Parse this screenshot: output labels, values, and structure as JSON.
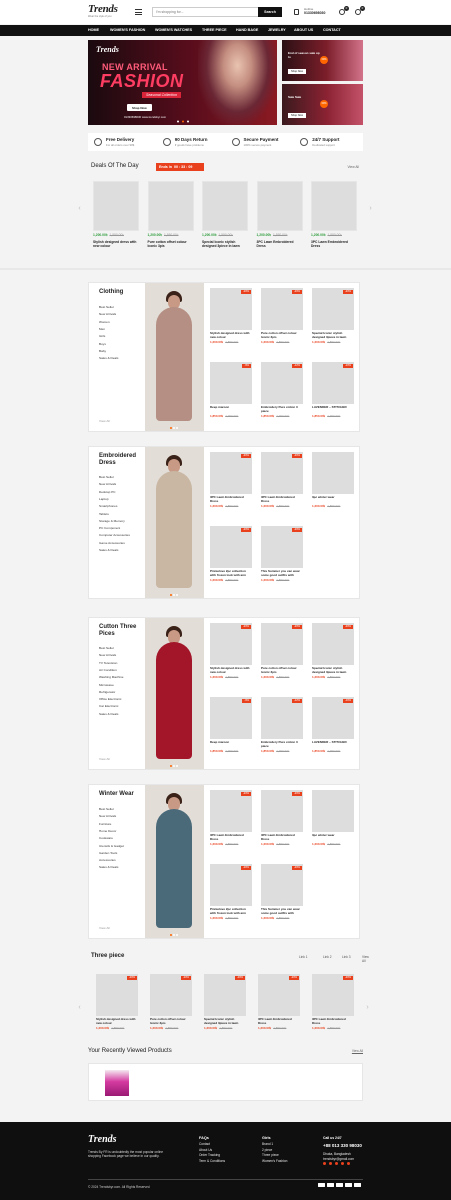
{
  "header": {
    "logo": "Trends",
    "logo_tagline": "Wear the style of you",
    "search_placeholder": "I'm shopping for...",
    "search_button": "Search",
    "hotline_label": "Hotline",
    "hotline_number": "01330698030",
    "wishlist_count": "0",
    "cart_count": "0"
  },
  "nav": [
    "Home",
    "Women's Fashion",
    "Women's Watches",
    "Three Piece",
    "Hand Bage",
    "Jewelry",
    "About Us",
    "Contact"
  ],
  "banner": {
    "brand": "Trends",
    "line1": "NEW ARRIVAL",
    "line2": "FASHION",
    "subtitle": "Seasonal Collection",
    "button": "Shop Now",
    "contact": "01330698030   www.trendsbyr.com"
  },
  "side_banners": [
    {
      "text": "End of season sale up to",
      "badge": "30%",
      "button": "Shop Now"
    },
    {
      "text": "Sale Sale",
      "badge": "30%",
      "button": "Shop Now"
    }
  ],
  "services": [
    {
      "title": "Free Delivery",
      "sub": "For all orders over 90$",
      "icon": "truck-icon"
    },
    {
      "title": "90 Days Return",
      "sub": "If goods have problems",
      "icon": "return-icon"
    },
    {
      "title": "Secure Payment",
      "sub": "100% secure payment",
      "icon": "card-icon"
    },
    {
      "title": "24/7 Support",
      "sub": "Dedicated support",
      "icon": "support-icon"
    }
  ],
  "deals": {
    "title": "Deals Of The Day",
    "ends_label": "Ends In",
    "timer": "00 : 33 : 09",
    "view_all": "View All",
    "products": [
      {
        "price": "1,200.00৳",
        "old": "1,550.00৳",
        "name": "Stylish designed dress with new colour",
        "img": "i1"
      },
      {
        "price": "1,200.00৳",
        "old": "1,550.00৳",
        "name": "Pure cotton offset colour Iconic 3pis",
        "img": "i2"
      },
      {
        "price": "1,200.00৳",
        "old": "1,550.00৳",
        "name": "Special Iconic stylish designed 3piece in lawn",
        "img": "i3"
      },
      {
        "price": "1,200.00৳",
        "old": "1,550.00৳",
        "name": "3PC Lawn Embroidered Dress",
        "img": "i4"
      },
      {
        "price": "1,200.00৳",
        "old": "1,550.00৳",
        "name": "3PC Lawn Embroidered Dress",
        "img": "i5"
      }
    ]
  },
  "categories": [
    {
      "title": "Clothing",
      "links": [
        "Best Seller",
        "New Arrivals",
        "Women",
        "Men",
        "Girls",
        "Boys",
        "Baby",
        "Sales & Deals"
      ],
      "view_all": "View All",
      "products": [
        {
          "name": "Stylish designed dress with new colour",
          "price": "1,200.00৳",
          "old": "1,550.00৳",
          "badge": "-20%",
          "img": "i1"
        },
        {
          "name": "Pure cotton offset colour Iconic 3pis",
          "price": "1,200.00৳",
          "old": "1,550.00৳",
          "badge": "-20%",
          "img": "i2"
        },
        {
          "name": "Special Iconic stylish designed 3piece in lawn",
          "price": "1,200.00৳",
          "old": "1,550.00৳",
          "badge": "-20%",
          "img": "i3"
        },
        {
          "name": "Deep maroon",
          "price": "1,850.00৳",
          "old": "1,900.00৳",
          "badge": "-9%",
          "img": "i6"
        },
        {
          "name": "Embroidery Pure cotton 3 piece",
          "price": "1,850.00৳",
          "old": "1,900.00৳",
          "badge": "-12%",
          "img": "i7"
        },
        {
          "name": "LAVENDER – STITCHED",
          "price": "1,850.00৳",
          "old": "1,900.00৳",
          "badge": "-10%",
          "img": "i8"
        }
      ]
    },
    {
      "title": "Embroidered Dress",
      "links": [
        "Best Seller",
        "New Arrivals",
        "Desktop PC",
        "Laptop",
        "Smartphones",
        "Tablets",
        "Storage & Memory",
        "PC Component",
        "Computer Accessories",
        "Game Accessories",
        "Sales & Deals"
      ],
      "view_all": "",
      "products": [
        {
          "name": "3PC Lawn Embroidered Dress",
          "price": "1,200.00৳",
          "old": "1,550.00৳",
          "badge": "-20%",
          "img": "i9"
        },
        {
          "name": "3PC Lawn Embroidered Dress",
          "price": "1,200.00৳",
          "old": "1,550.00৳",
          "badge": "-20%",
          "img": "i5"
        },
        {
          "name": "3pc winter wear",
          "price": "1,200.00৳",
          "old": "1,550.00৳",
          "badge": "",
          "img": "i10"
        },
        {
          "name": "Pinnielove 2pc collection with frozen look with ann Fashion",
          "price": "1,200.00৳",
          "old": "1,550.00৳",
          "badge": "-20%",
          "img": "i11"
        },
        {
          "name": "This Summer you can wear some good outfits with stylish",
          "price": "1,200.00৳",
          "old": "1,550.00৳",
          "badge": "-20%",
          "img": "i12"
        }
      ]
    },
    {
      "title": "Cutton Three Pices",
      "links": [
        "Best Seller",
        "New Arrivals",
        "TV Television",
        "Air Condition",
        "Washing Machine",
        "Microwave",
        "Refrigerator",
        "Office Electronic",
        "Car Electronic",
        "Sales & Deals"
      ],
      "view_all": "View All",
      "products": [
        {
          "name": "Stylish designed dress with new colour",
          "price": "1,200.00৳",
          "old": "1,550.00৳",
          "badge": "-20%",
          "img": "i1"
        },
        {
          "name": "Pure cotton offset colour Iconic 3pis",
          "price": "1,200.00৳",
          "old": "1,550.00৳",
          "badge": "-20%",
          "img": "i2"
        },
        {
          "name": "Special Iconic stylish designed 3piece in lawn",
          "price": "1,200.00৳",
          "old": "1,550.00৳",
          "badge": "-20%",
          "img": "i3"
        },
        {
          "name": "Deep maroon",
          "price": "1,850.00৳",
          "old": "1,900.00৳",
          "badge": "-9%",
          "img": "i6"
        },
        {
          "name": "Embroidery Pure cotton 3 piece",
          "price": "1,850.00৳",
          "old": "1,900.00৳",
          "badge": "-12%",
          "img": "i7"
        },
        {
          "name": "LAVENDER – STITCHED",
          "price": "1,850.00৳",
          "old": "1,900.00৳",
          "badge": "-10%",
          "img": "i8"
        }
      ]
    },
    {
      "title": "Winter Wear",
      "links": [
        "Best Seller",
        "New Arrivals",
        "Furniture",
        "Home Decor",
        "Cookware",
        "Utensils & Gadget",
        "Garden Tools",
        "Accessories",
        "Sales & Deals"
      ],
      "view_all": "View All",
      "products": [
        {
          "name": "3PC Lawn Embroidered Dress",
          "price": "1,200.00৳",
          "old": "1,550.00৳",
          "badge": "-20%",
          "img": "i9"
        },
        {
          "name": "3PC Lawn Embroidered Dress",
          "price": "1,200.00৳",
          "old": "1,550.00৳",
          "badge": "-20%",
          "img": "i5"
        },
        {
          "name": "3pc winter wear",
          "price": "1,200.00৳",
          "old": "1,550.00৳",
          "badge": "",
          "img": "i10"
        },
        {
          "name": "Pinnielove 2pc collection with frozen look with ann Fashion",
          "price": "1,200.00৳",
          "old": "1,550.00৳",
          "badge": "-20%",
          "img": "i11"
        },
        {
          "name": "This Summer you can wear some good outfits with stylish",
          "price": "1,200.00৳",
          "old": "1,550.00৳",
          "badge": "-20%",
          "img": "i12"
        }
      ]
    }
  ],
  "three_piece": {
    "title": "Three piece",
    "links": [
      "Link 1",
      "Link 2",
      "Link 3",
      "View All"
    ],
    "products": [
      {
        "name": "Stylish designed dress with new colour",
        "price": "1,200.00৳",
        "old": "1,550.00৳",
        "badge": "-20%",
        "img": "i1"
      },
      {
        "name": "Pure cotton offset colour Iconic 3pis",
        "price": "1,200.00৳",
        "old": "1,550.00৳",
        "badge": "-20%",
        "img": "i2"
      },
      {
        "name": "Special Iconic stylish designed 3piece in lawn",
        "price": "1,200.00৳",
        "old": "1,550.00৳",
        "badge": "-20%",
        "img": "i3"
      },
      {
        "name": "3PC Lawn Embroidered Dress",
        "price": "1,200.00৳",
        "old": "1,550.00৳",
        "badge": "-20%",
        "img": "i4"
      },
      {
        "name": "3PC Lawn Embroidered Dress",
        "price": "1,200.00৳",
        "old": "1,550.00৳",
        "badge": "-20%",
        "img": "i5"
      }
    ]
  },
  "recently_viewed": {
    "title": "Your Recently Viewed Products",
    "view_all": "View All"
  },
  "footer": {
    "logo": "Trends",
    "about": "Trends By FR is undoubtedly the most popular online shopping Facebook page we believe in our quality.",
    "col1_head": "FAQs",
    "col1": [
      "Contact",
      "About Us",
      "Order Tracking",
      "Term & Conditions"
    ],
    "col2_head": "Girls",
    "col2": [
      "Brand 1",
      "2 piece",
      "Three piece",
      "Women's Fashion"
    ],
    "contact_head": "Call us 24/7",
    "phone": "+88 013 330 98030",
    "location": "Dhaka, Bangladesh",
    "email": "trendsbyr@gmail.com",
    "copyright": "© 2024 Trendsbyr.com. All Rights Reserved"
  },
  "colors": {
    "accent": "#e9411e",
    "price_green": "#2e9b3c",
    "dark": "#111111"
  }
}
